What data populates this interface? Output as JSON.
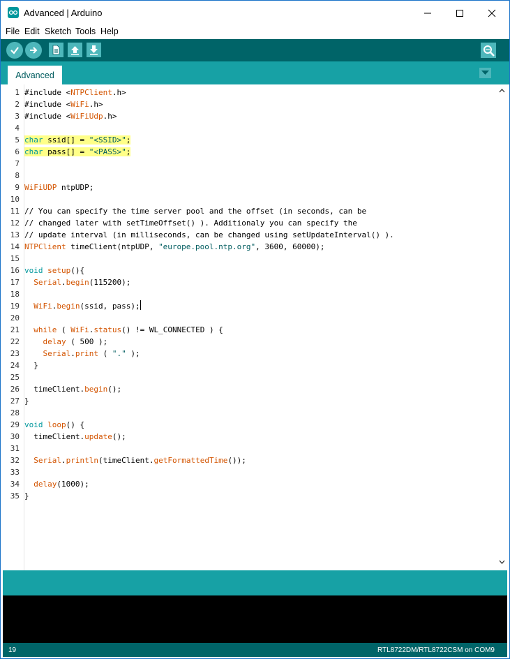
{
  "window": {
    "title": "Advanced | Arduino",
    "controls": [
      "minimize",
      "maximize",
      "close"
    ]
  },
  "menu": [
    "File",
    "Edit",
    "Sketch",
    "Tools",
    "Help"
  ],
  "toolbar": {
    "buttons": [
      "verify-icon",
      "upload-icon",
      "new-icon",
      "open-icon",
      "save-icon",
      "serial-monitor-icon"
    ]
  },
  "tabs": [
    {
      "label": "Advanced"
    }
  ],
  "editor": {
    "lines": [
      {
        "n": "1",
        "parts": [
          [
            "n",
            "#include <"
          ],
          [
            "red",
            "NTPClient"
          ],
          [
            "n",
            ".h>"
          ]
        ]
      },
      {
        "n": "2",
        "parts": [
          [
            "n",
            "#include <"
          ],
          [
            "red",
            "WiFi"
          ],
          [
            "n",
            ".h>"
          ]
        ]
      },
      {
        "n": "3",
        "parts": [
          [
            "n",
            "#include <"
          ],
          [
            "red",
            "WiFiUdp"
          ],
          [
            "n",
            ".h>"
          ]
        ]
      },
      {
        "n": "4",
        "parts": []
      },
      {
        "n": "5",
        "hl": true,
        "parts": [
          [
            "teal",
            "char"
          ],
          [
            "n",
            " ssid[] = "
          ],
          [
            "blue",
            "\"<SSID>\""
          ],
          [
            "n",
            ";"
          ]
        ]
      },
      {
        "n": "6",
        "hl": true,
        "parts": [
          [
            "teal",
            "char"
          ],
          [
            "n",
            " pass[] = "
          ],
          [
            "blue",
            "\"<PASS>\""
          ],
          [
            "n",
            ";"
          ]
        ]
      },
      {
        "n": "7",
        "parts": []
      },
      {
        "n": "8",
        "parts": []
      },
      {
        "n": "9",
        "parts": [
          [
            "red",
            "WiFiUDP"
          ],
          [
            "n",
            " ntpUDP;"
          ]
        ]
      },
      {
        "n": "10",
        "parts": []
      },
      {
        "n": "11",
        "parts": [
          [
            "n",
            "// You can specify the time server pool and the offset (in seconds, can be"
          ]
        ]
      },
      {
        "n": "12",
        "parts": [
          [
            "n",
            "// changed later with setTimeOffset() ). Additionaly you can specify the"
          ]
        ]
      },
      {
        "n": "13",
        "parts": [
          [
            "n",
            "// update interval (in milliseconds, can be changed using setUpdateInterval() )."
          ]
        ]
      },
      {
        "n": "14",
        "parts": [
          [
            "red",
            "NTPClient"
          ],
          [
            "n",
            " timeClient(ntpUDP, "
          ],
          [
            "blue",
            "\"europe.pool.ntp.org\""
          ],
          [
            "n",
            ", 3600, 60000);"
          ]
        ]
      },
      {
        "n": "15",
        "parts": []
      },
      {
        "n": "16",
        "parts": [
          [
            "teal",
            "void"
          ],
          [
            "n",
            " "
          ],
          [
            "red",
            "setup"
          ],
          [
            "n",
            "(){"
          ]
        ]
      },
      {
        "n": "17",
        "parts": [
          [
            "n",
            "  "
          ],
          [
            "red",
            "Serial"
          ],
          [
            "n",
            "."
          ],
          [
            "red",
            "begin"
          ],
          [
            "n",
            "(115200);"
          ]
        ]
      },
      {
        "n": "18",
        "parts": []
      },
      {
        "n": "19",
        "cursor": true,
        "parts": [
          [
            "n",
            "  "
          ],
          [
            "red",
            "WiFi"
          ],
          [
            "n",
            "."
          ],
          [
            "red",
            "begin"
          ],
          [
            "n",
            "(ssid, pass);"
          ]
        ]
      },
      {
        "n": "20",
        "parts": []
      },
      {
        "n": "21",
        "parts": [
          [
            "n",
            "  "
          ],
          [
            "red",
            "while"
          ],
          [
            "n",
            " ( "
          ],
          [
            "red",
            "WiFi"
          ],
          [
            "n",
            "."
          ],
          [
            "red",
            "status"
          ],
          [
            "n",
            "() != WL_CONNECTED ) {"
          ]
        ]
      },
      {
        "n": "22",
        "parts": [
          [
            "n",
            "    "
          ],
          [
            "red",
            "delay"
          ],
          [
            "n",
            " ( 500 );"
          ]
        ]
      },
      {
        "n": "23",
        "parts": [
          [
            "n",
            "    "
          ],
          [
            "red",
            "Serial"
          ],
          [
            "n",
            "."
          ],
          [
            "red",
            "print"
          ],
          [
            "n",
            " ( "
          ],
          [
            "blue",
            "\".\""
          ],
          [
            "n",
            " );"
          ]
        ]
      },
      {
        "n": "24",
        "parts": [
          [
            "n",
            "  }"
          ]
        ]
      },
      {
        "n": "25",
        "parts": []
      },
      {
        "n": "26",
        "parts": [
          [
            "n",
            "  timeClient."
          ],
          [
            "red",
            "begin"
          ],
          [
            "n",
            "();"
          ]
        ]
      },
      {
        "n": "27",
        "parts": [
          [
            "n",
            "}"
          ]
        ]
      },
      {
        "n": "28",
        "parts": []
      },
      {
        "n": "29",
        "parts": [
          [
            "teal",
            "void"
          ],
          [
            "n",
            " "
          ],
          [
            "red",
            "loop"
          ],
          [
            "n",
            "() {"
          ]
        ]
      },
      {
        "n": "30",
        "parts": [
          [
            "n",
            "  timeClient."
          ],
          [
            "red",
            "update"
          ],
          [
            "n",
            "();"
          ]
        ]
      },
      {
        "n": "31",
        "parts": []
      },
      {
        "n": "32",
        "parts": [
          [
            "n",
            "  "
          ],
          [
            "red",
            "Serial"
          ],
          [
            "n",
            "."
          ],
          [
            "red",
            "println"
          ],
          [
            "n",
            "(timeClient."
          ],
          [
            "red",
            "getFormattedTime"
          ],
          [
            "n",
            "());"
          ]
        ]
      },
      {
        "n": "33",
        "parts": []
      },
      {
        "n": "34",
        "parts": [
          [
            "n",
            "  "
          ],
          [
            "red",
            "delay"
          ],
          [
            "n",
            "(1000);"
          ]
        ]
      },
      {
        "n": "35",
        "parts": [
          [
            "n",
            "}"
          ]
        ]
      }
    ]
  },
  "status": {
    "line_number": "19",
    "board": "RTL8722DM/RTL8722CSM on COM9"
  },
  "colors": {
    "toolbar": "#006468",
    "tabbar": "#17a1a5",
    "button": "#4db7bb",
    "keyword_red": "#d35400",
    "keyword_teal": "#00979c",
    "string": "#005c5f",
    "highlight": "#ffff88"
  }
}
